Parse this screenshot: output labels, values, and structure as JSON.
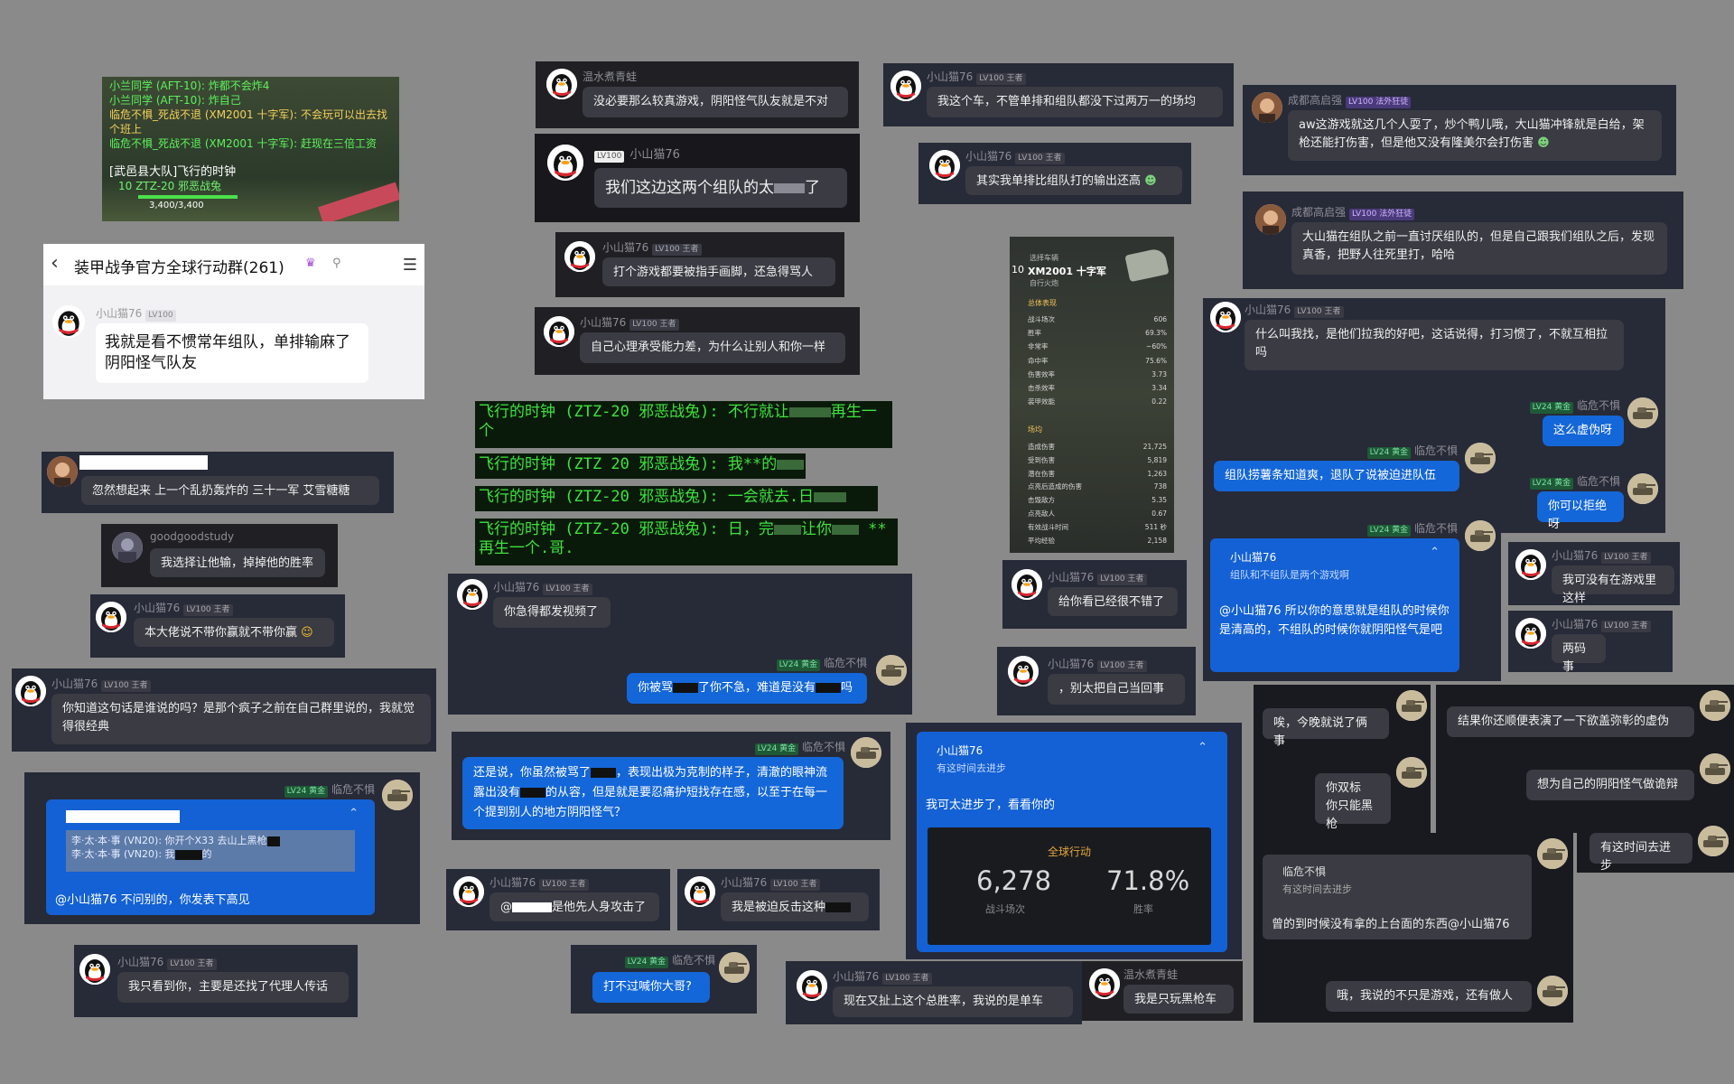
{
  "game_feed": {
    "lines": [
      "小兰同学 (AFT-10): 炸都不会炸4",
      "小兰同学 (AFT-10): 炸自己",
      "临危不惧_死战不退 (XM2001 十字军): 不会玩可以出去找个班上",
      "临危不惧_死战不退 (XM2001 十字军): 赶现在三倍工资"
    ],
    "team_label": "[武邑县大队]飞行的时钟",
    "vehicle": "10 ZTZ-20 邪恶战兔",
    "hp": "3,400/3,400"
  },
  "group_header": {
    "title": "装甲战争官方全球行动群(261)",
    "sender": "小山猫76",
    "level": "LV100",
    "message": "我就是看不惯常年组队，单排输麻了阴阳怪气队友"
  },
  "users": {
    "cat": "小山猫76",
    "wen": "温水煮青蛙",
    "chengdu": "成都高启强",
    "fear": "临危不惧",
    "good": "goodgoodstudy"
  },
  "badges": {
    "king": "LV100 王者",
    "plain": "LV100",
    "gold": "LV24 黄金",
    "legend": "LV100 法外狂徒"
  },
  "messages": {
    "m_wen1": "没必要那么较真游戏，阴阳怪气队友就是不对",
    "m_cat_big": "我们这边这两个组队的太",
    "m_cat_big_tail": "了",
    "m_cat_a": "打个游戏都要被指手画脚，还急得骂人",
    "m_cat_b": "自己心理承受能力差，为什么让别人和你一样",
    "m_cat_c": "我这个车，不管单排和组队都没下过两万一的场均",
    "m_cat_d": "其实我单排比组队打的输出还高",
    "m_cd1": "aw这游戏就这几个人耍了，炒个鸭儿哦，大山猫冲锋就是白给，架枪还能打伤害，但是他又没有隆美尔会打伤害",
    "m_cd2": "大山猫在组队之前一直讨厌组队的，但是自己跟我们组队之后，发现真香，把野人往死里打，哈哈",
    "m_cat_e": "什么叫我找，是他们拉我的好吧，这话说得，打习惯了，不就互相拉吗",
    "m_fear_a": "这么虚伪呀",
    "m_fear_b": "组队捞薯条知道爽，退队了说被迫进队伍",
    "m_fear_c": "你可以拒绝呀",
    "m_fear_quote_name": "小山猫76",
    "m_fear_quote_text": "组队和不组队是两个游戏啊",
    "m_fear_reply": "@小山猫76 所以你的意思就是组队的时候你是清高的，不组队的时候你就阴阳怪气是吧",
    "m_cat_f": "我可没有在游戏里这样",
    "m_cat_g": "两码事",
    "m_good": "我选择让他输，掉掉他的胜率",
    "m_anon1": "忽然想起来 上一个乱扔轰炸的 三十一军 艾雪糖糖",
    "m_cat_h": "本大佬说不带你赢就不带你赢",
    "m_cat_i": "你知道这句话是谁说的吗？是那个疯子之前在自己群里说的，我就觉得很经典",
    "m_fear_quote2_a": "李·太·本·事 (VN20): 你开个X33 去山上黑枪",
    "m_fear_quote2_b": "李·太·本·事 (VN20): 我",
    "m_fear_quote2_c": "的",
    "m_fear_quote2_reply": "@小山猫76 不问别的，你发表下高见",
    "m_cat_j": "我只看到你，主要是还找了代理人传话",
    "m_clock_1": "飞行的时钟 (ZTZ-20 邪恶战兔): 不行就让",
    "m_clock_1b": "再生一个",
    "m_clock_2": "飞行的时钟 (ZTZ 20 邪恶战兔): 我**的",
    "m_clock_3": "飞行的时钟 (ZTZ-20 邪恶战兔): 一会就去.日",
    "m_clock_4": "飞行的时钟 (ZTZ-20 邪恶战兔): 日，完",
    "m_clock_4b": "让你",
    "m_clock_4c": "**",
    "m_clock_4d": "再生一个.哥.",
    "m_cat_k": "你急得都发视频了",
    "m_fear_d1": "你被骂",
    "m_fear_d2": "了你不急，难道是没有",
    "m_fear_d3": "吗",
    "m_fear_e1": "还是说，你虽然被骂了",
    "m_fear_e2": "，表现出极为克制的样子，清澈的眼神流露出没有",
    "m_fear_e3": "的从容，但是就是要忍痛护短找存在感，以至于在每一个提到别人的地方阴阳怪气？",
    "m_cat_l1": "@",
    "m_cat_l2": "是他先人身攻击了",
    "m_cat_m": "我是被迫反击这种",
    "m_fear_f": "打不过喊你大哥?",
    "m_cat_n": "给你看已经很不错了",
    "m_cat_o": "，别太把自己当回事",
    "m_cat_quote_name": "小山猫76",
    "m_cat_quote_text": "有这时间去进步",
    "m_cat_p": "我可太进步了，看看你的",
    "stats_title": "全球行动",
    "stats_battles": "6,278",
    "stats_battles_label": "战斗场次",
    "stats_win": "71.8%",
    "stats_win_label": "胜率",
    "m_cat_q": "现在又扯上这个总胜率，我说的是单车",
    "m_wen2": "我是只玩黑枪车",
    "m_fear_g": "唉，今晚就说了俩事",
    "m_fear_h1": "你双标",
    "m_fear_h2": "你只能黑枪",
    "m_fear_i": "结果你还顺便表演了一下欲盖弥彰的虚伪",
    "m_fear_j": "想为自己的阴阳怪气做诡辩",
    "m_fear_k": "有这时间去进步",
    "m_fear_quote3_name": "临危不惧",
    "m_fear_quote3_text": "有这时间去进步",
    "m_fear_l": "曾的到时候没有拿的上台面的东西@小山猫76",
    "m_fear_m": "哦，我说的不只是游戏，还有做人"
  },
  "stats_panel": {
    "tier": "10",
    "tank": "XM2001 十字军",
    "tank_class": "自行火炮",
    "label_top": "选择车辆",
    "section1": "总体表现",
    "rows1": [
      {
        "k": "战斗场次",
        "v": "606"
      },
      {
        "k": "胜率",
        "v": "69.3%"
      },
      {
        "k": "非常率",
        "v": "~60%"
      },
      {
        "k": "命中率",
        "v": "75.6%"
      },
      {
        "k": "伤害效率",
        "v": "3.73"
      },
      {
        "k": "击杀效率",
        "v": "3.34"
      },
      {
        "k": "装甲效能",
        "v": "0.22"
      }
    ],
    "section2": "场均",
    "rows2": [
      {
        "k": "造成伤害",
        "v": "21,725"
      },
      {
        "k": "受到伤害",
        "v": "5,819"
      },
      {
        "k": "潜在伤害",
        "v": "1,263"
      },
      {
        "k": "点亮后造成的伤害",
        "v": "738"
      },
      {
        "k": "击毁敌方",
        "v": "5.35"
      },
      {
        "k": "点亮敌人",
        "v": "0.67"
      },
      {
        "k": "有效战斗时间",
        "v": "511 秒"
      },
      {
        "k": "平均经验",
        "v": "2,158"
      }
    ]
  }
}
